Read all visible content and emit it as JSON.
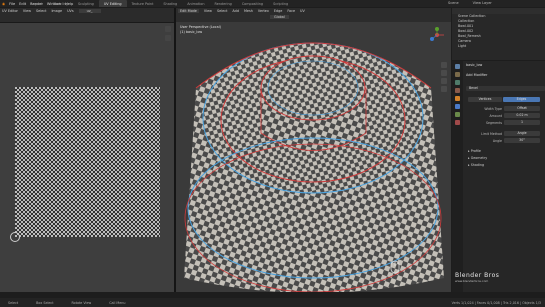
{
  "menu": [
    "File",
    "Edit",
    "Render",
    "Window",
    "Help"
  ],
  "workspaces": [
    {
      "label": "Layout",
      "active": false
    },
    {
      "label": "Modeling",
      "active": false
    },
    {
      "label": "Sculpting",
      "active": false
    },
    {
      "label": "UV Editing",
      "active": true
    },
    {
      "label": "Texture Paint",
      "active": false
    },
    {
      "label": "Shading",
      "active": false
    },
    {
      "label": "Animation",
      "active": false
    },
    {
      "label": "Rendering",
      "active": false
    },
    {
      "label": "Compositing",
      "active": false
    },
    {
      "label": "Scripting",
      "active": false
    }
  ],
  "scene_label": "Scene",
  "view_layer": "View Layer",
  "uv_editor": {
    "mode": "UV Editor",
    "menus": [
      "View",
      "Select",
      "Image",
      "UVs"
    ],
    "image": "uv_"
  },
  "viewport": {
    "mode": "Edit Mode",
    "menus": [
      "View",
      "Select",
      "Add",
      "Mesh",
      "Vertex",
      "Edge",
      "Face",
      "UV"
    ],
    "transform": "Global",
    "info_line1": "User Perspective (Local)",
    "info_line2": "(1) basic_low"
  },
  "outliner": {
    "rows": [
      "Scene Collection",
      "Collection",
      "Bowl.001",
      "Bowl.002",
      "Bowl_Remesh",
      "Camera",
      "Light"
    ]
  },
  "properties": {
    "object": "basic_low",
    "modifier_label": "Add Modifier",
    "modifier_name": "Bevel",
    "toggle_vertices": "Vertices",
    "toggle_edges": "Edges",
    "width_type_label": "Width Type",
    "width_type_value": "Offset",
    "amount_label": "Amount",
    "amount_value": "0.02 m",
    "segments_label": "Segments",
    "segments_value": "1",
    "limit_label": "Limit Method",
    "limit_value": "Angle",
    "angle_label": "Angle",
    "angle_value": "30°",
    "sections": [
      "Profile",
      "Geometry",
      "Shading"
    ]
  },
  "status": {
    "select": "Select",
    "box": "Box Select",
    "rotate": "Rotate View",
    "call": "Call Menu",
    "stats": "Verts 1/1,024 | Faces 0/1,008 | Tris 2,016 | Objects 1/3"
  },
  "branding": {
    "name": "Blender Bros",
    "url": "www.blenderbros.com"
  }
}
